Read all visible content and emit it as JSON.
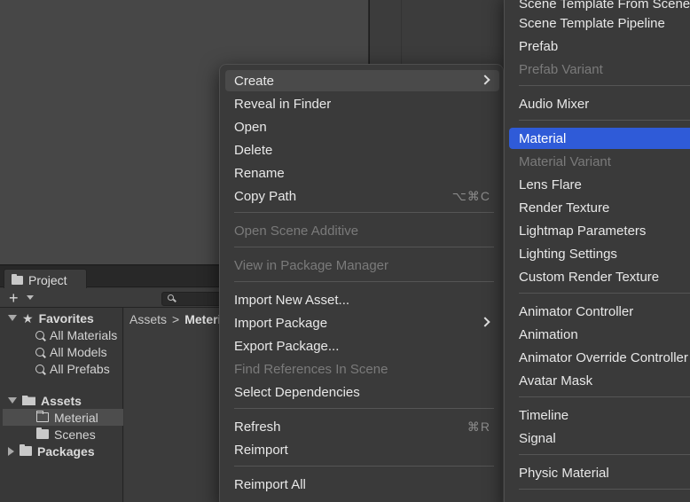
{
  "project": {
    "tab_label": "Project",
    "plus_label": "+",
    "favorites": {
      "label": "Favorites",
      "items": [
        "All Materials",
        "All Models",
        "All Prefabs"
      ]
    },
    "assets": {
      "label": "Assets",
      "items": [
        "Meterial",
        "Scenes"
      ]
    },
    "packages_label": "Packages",
    "breadcrumb": [
      "Assets",
      "Meterial"
    ],
    "breadcrumb_sep": ">"
  },
  "context_menu": {
    "items": [
      {
        "label": "Create",
        "submenu": true
      },
      {
        "label": "Reveal in Finder"
      },
      {
        "label": "Open"
      },
      {
        "label": "Delete"
      },
      {
        "label": "Rename"
      },
      {
        "label": "Copy Path",
        "shortcut": "⌥⌘C"
      },
      {
        "label": "Open Scene Additive",
        "disabled": true
      },
      {
        "label": "View in Package Manager",
        "disabled": true
      },
      {
        "label": "Import New Asset..."
      },
      {
        "label": "Import Package",
        "submenu": true
      },
      {
        "label": "Export Package..."
      },
      {
        "label": "Find References In Scene",
        "disabled": true
      },
      {
        "label": "Select Dependencies"
      },
      {
        "label": "Refresh",
        "shortcut": "⌘R"
      },
      {
        "label": "Reimport"
      },
      {
        "label": "Reimport All"
      }
    ]
  },
  "submenu": {
    "items": [
      {
        "label": "Scene Template From Scene"
      },
      {
        "label": "Scene Template Pipeline"
      },
      {
        "label": "Prefab"
      },
      {
        "label": "Prefab Variant",
        "disabled": true
      },
      {
        "label": "Audio Mixer"
      },
      {
        "label": "Material",
        "selected": true
      },
      {
        "label": "Material Variant",
        "disabled": true
      },
      {
        "label": "Lens Flare"
      },
      {
        "label": "Render Texture"
      },
      {
        "label": "Lightmap Parameters"
      },
      {
        "label": "Lighting Settings"
      },
      {
        "label": "Custom Render Texture"
      },
      {
        "label": "Animator Controller"
      },
      {
        "label": "Animation"
      },
      {
        "label": "Animator Override Controller"
      },
      {
        "label": "Avatar Mask"
      },
      {
        "label": "Timeline"
      },
      {
        "label": "Signal"
      },
      {
        "label": "Physic Material"
      }
    ]
  },
  "colors": {
    "selection": "#2f5bd8",
    "menu_bg": "#3a3a3a"
  }
}
